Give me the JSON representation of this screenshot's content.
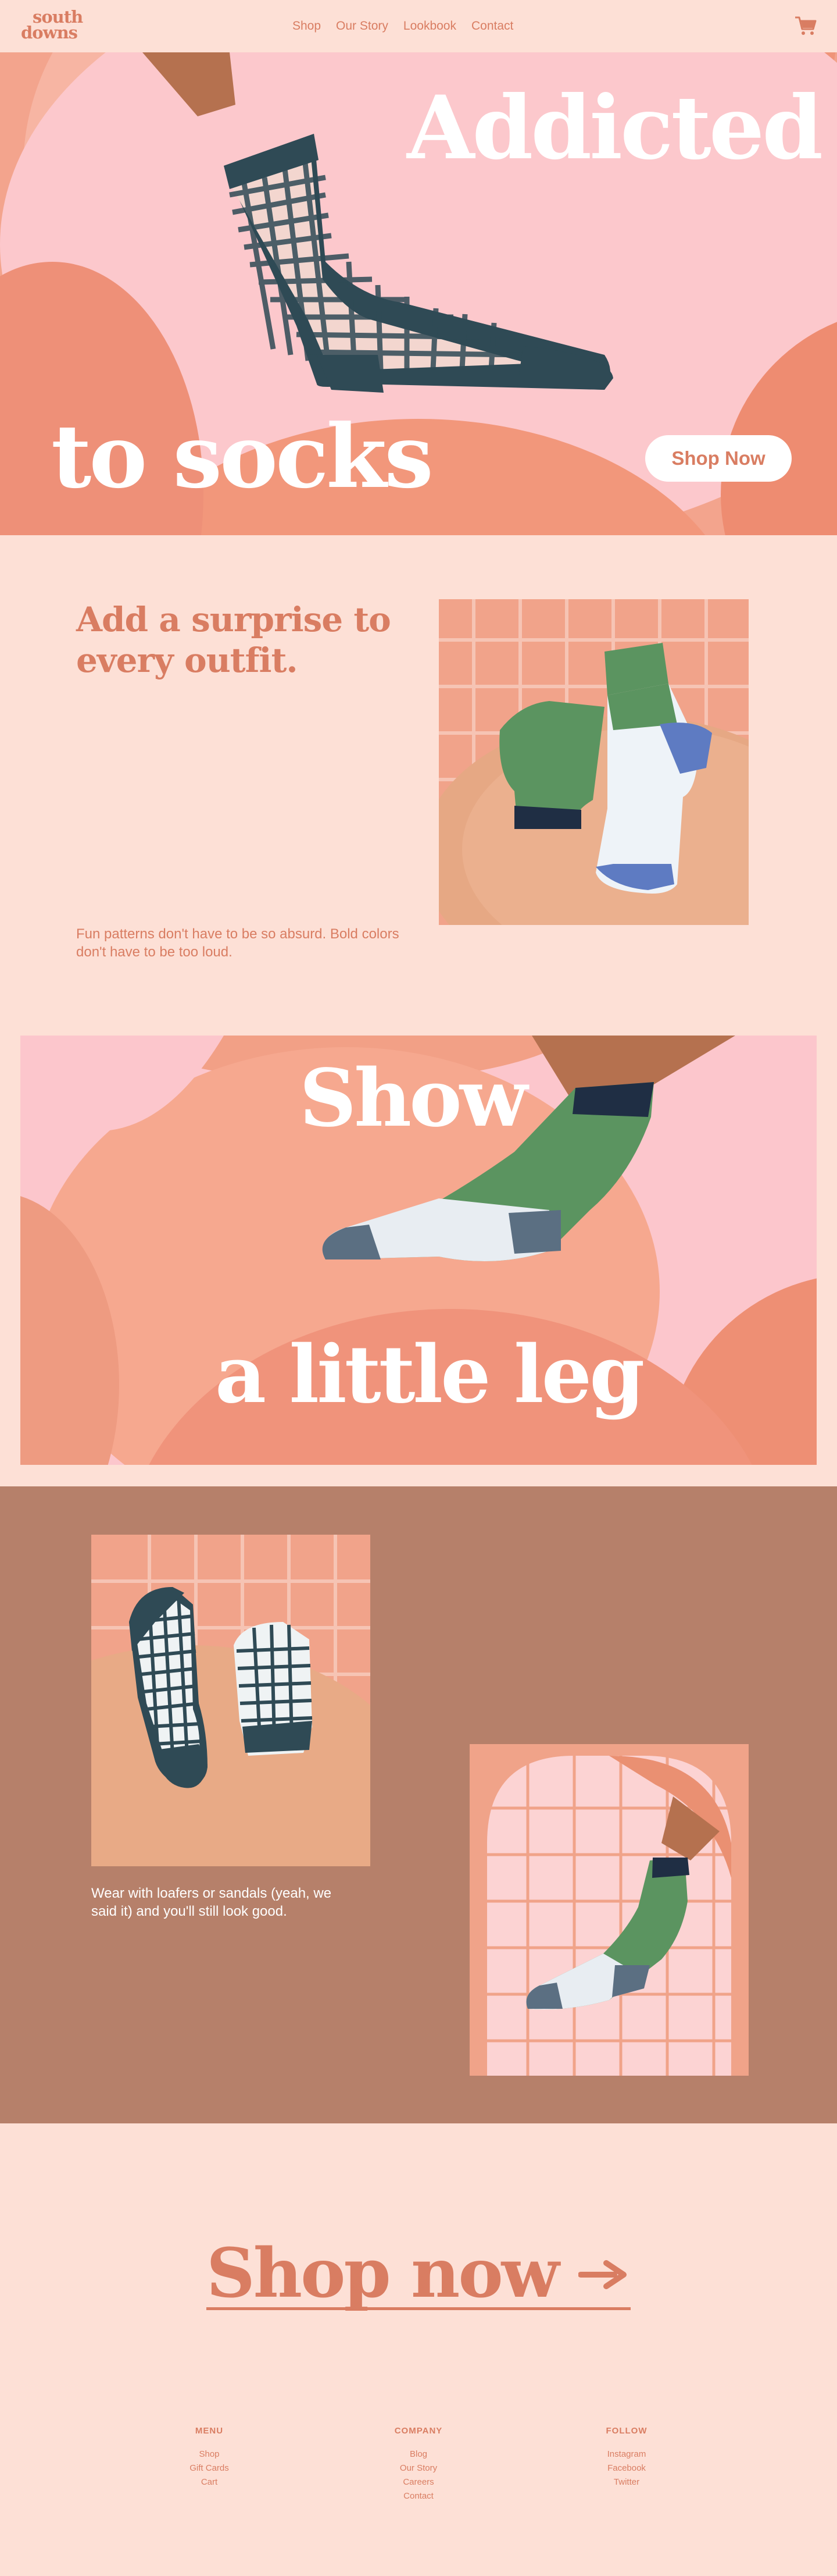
{
  "header": {
    "logo_line1": "south",
    "logo_line2": "downs",
    "nav": [
      "Shop",
      "Our Story",
      "Lookbook",
      "Contact"
    ]
  },
  "hero": {
    "title_top": "Addicted",
    "title_bottom": "to socks",
    "button": "Shop Now"
  },
  "surprise": {
    "heading": "Add a surprise to every outfit.",
    "body": "Fun patterns don't have to be so absurd. Bold colors don't have to be too loud."
  },
  "leg": {
    "title_top": "Show",
    "title_bottom": "a little leg"
  },
  "lookbook": {
    "caption": "Wear with loafers or sandals (yeah, we said it) and you'll still look good."
  },
  "cta": {
    "label": "Shop now"
  },
  "footer": {
    "columns": [
      {
        "heading": "MENU",
        "links": [
          "Shop",
          "Gift Cards",
          "Cart"
        ]
      },
      {
        "heading": "COMPANY",
        "links": [
          "Blog",
          "Our Story",
          "Careers",
          "Contact"
        ]
      },
      {
        "heading": "FOLLOW",
        "links": [
          "Instagram",
          "Facebook",
          "Twitter"
        ]
      }
    ]
  },
  "colors": {
    "background": "#fde0d6",
    "accent": "#d97d62",
    "brown": "#b6806a",
    "sock_green": "#5b9460",
    "sock_navy": "#2f4a55"
  }
}
